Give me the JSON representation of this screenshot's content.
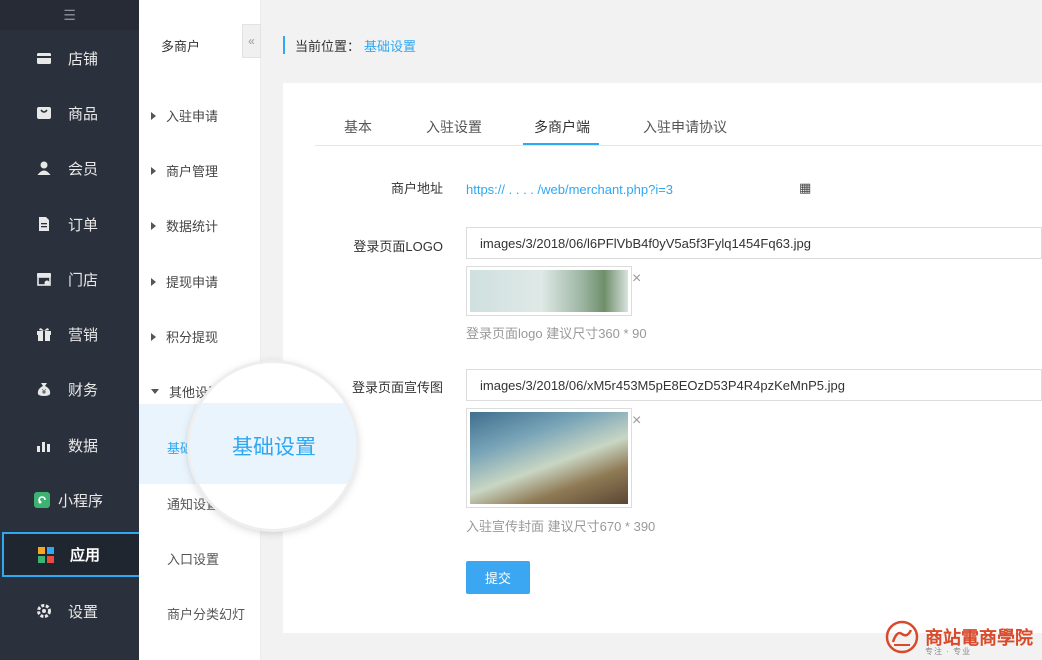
{
  "nav": {
    "toggle_glyph": "☰",
    "items": [
      {
        "label": "店铺",
        "icon": "store-icon"
      },
      {
        "label": "商品",
        "icon": "bag-icon"
      },
      {
        "label": "会员",
        "icon": "user-icon"
      },
      {
        "label": "订单",
        "icon": "document-icon"
      },
      {
        "label": "门店",
        "icon": "shop-front-icon"
      },
      {
        "label": "营销",
        "icon": "gift-icon"
      },
      {
        "label": "财务",
        "icon": "money-bag-icon"
      },
      {
        "label": "数据",
        "icon": "bar-chart-icon"
      },
      {
        "label": "小程序",
        "icon": "mini-program-icon"
      },
      {
        "label": "应用",
        "icon": "apps-icon",
        "active": true
      },
      {
        "label": "设置",
        "icon": "gear-icon"
      }
    ]
  },
  "submenu": {
    "title": "多商户",
    "collapse_glyph": "«",
    "groups": [
      {
        "label": "入驻申请"
      },
      {
        "label": "商户管理"
      },
      {
        "label": "数据统计"
      },
      {
        "label": "提现申请"
      },
      {
        "label": "积分提现"
      },
      {
        "label": "其他设置",
        "expanded": true
      }
    ],
    "leaves": [
      {
        "label": "基础设置",
        "active": true
      },
      {
        "label": "通知设置"
      },
      {
        "label": "入口设置"
      },
      {
        "label": "商户分类幻灯"
      }
    ]
  },
  "breadcrumb": {
    "label": "当前位置：",
    "current": "基础设置"
  },
  "tabs": [
    {
      "label": "基本"
    },
    {
      "label": "入驻设置"
    },
    {
      "label": "多商户端",
      "active": true
    },
    {
      "label": "入驻申请协议"
    }
  ],
  "form": {
    "merchant_url_label": "商户地址",
    "merchant_url": "https://  .  .  .  .  /web/merchant.php?i=3",
    "qr_glyph": "▦",
    "logo_label": "登录页面LOGO",
    "logo_value": "images/3/2018/06/l6PFlVbB4f0yV5a5f3Fylq1454Fq63.jpg",
    "logo_hint": "登录页面logo 建议尺寸360 * 90",
    "promo_label": "登录页面宣传图",
    "promo_value": "images/3/2018/06/xM5r453M5pE8EOzD53P4R4pzKeMnP5.jpg",
    "promo_hint": "入驻宣传封面 建议尺寸670 * 390",
    "remove_glyph": "×",
    "submit_label": "提交"
  },
  "magnifier": {
    "text": "基础设置"
  },
  "watermark": {
    "text": "商站電商學院",
    "sub": "专注 · 专业"
  },
  "colors": {
    "accent": "#2ea8f3",
    "nav_bg": "#2b313c",
    "watermark": "#d94a2a"
  }
}
